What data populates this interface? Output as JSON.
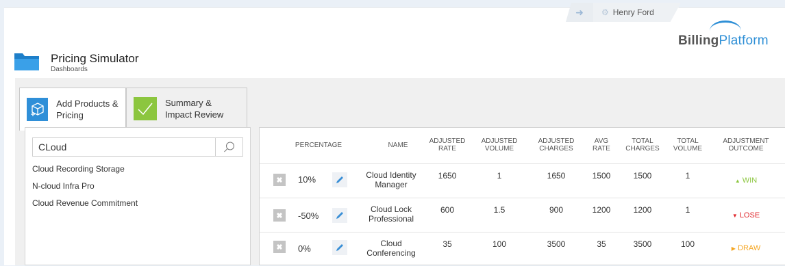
{
  "topbar": {
    "back_icon": "arrow-left-icon",
    "user_name": "Henry Ford"
  },
  "logo": {
    "part1": "Billing",
    "part2": "Platform"
  },
  "page": {
    "title": "Pricing Simulator",
    "subtitle": "Dashboards"
  },
  "tabs": [
    {
      "label": "Add Products & Pricing",
      "icon": "box-plus-icon",
      "active": true
    },
    {
      "label": "Summary & Impact Review",
      "icon": "checkmark-icon",
      "active": false
    }
  ],
  "search": {
    "value": "CLoud"
  },
  "results": [
    "Cloud Recording Storage",
    "N-cloud Infra Pro",
    "Cloud Revenue Commitment"
  ],
  "table": {
    "headers": {
      "percentage": "PERCENTAGE",
      "name": "NAME",
      "adj_rate": "ADJUSTED RATE",
      "adj_volume": "ADJUSTED VOLUME",
      "adj_charges": "ADJUSTED CHARGES",
      "avg_rate": "AVG RATE",
      "total_charges": "TOTAL CHARGES",
      "total_volume": "TOTAL VOLUME",
      "outcome": "ADJUSTMENT OUTCOME"
    },
    "rows": [
      {
        "percentage": "10%",
        "name": "Cloud Identity Manager",
        "adj_rate": "1650",
        "adj_volume": "1",
        "adj_charges": "1650",
        "avg_rate": "1500",
        "total_charges": "1500",
        "total_volume": "1",
        "outcome": "WIN",
        "outcome_icon": "▲",
        "outcome_color": "#8cc63f"
      },
      {
        "percentage": "-50%",
        "name": "Cloud Lock Professional",
        "adj_rate": "600",
        "adj_volume": "1.5",
        "adj_charges": "900",
        "avg_rate": "1200",
        "total_charges": "1200",
        "total_volume": "1",
        "outcome": "LOSE",
        "outcome_icon": "▼",
        "outcome_color": "#e0262b"
      },
      {
        "percentage": "0%",
        "name": "Cloud Conferencing",
        "adj_rate": "35",
        "adj_volume": "100",
        "adj_charges": "3500",
        "avg_rate": "35",
        "total_charges": "3500",
        "total_volume": "100",
        "outcome": "DRAW",
        "outcome_icon": "▶",
        "outcome_color": "#f5a623"
      }
    ]
  },
  "colors": {
    "accent": "#2f8fd8",
    "success": "#8cc63f",
    "danger": "#e0262b",
    "warning": "#f5a623"
  }
}
